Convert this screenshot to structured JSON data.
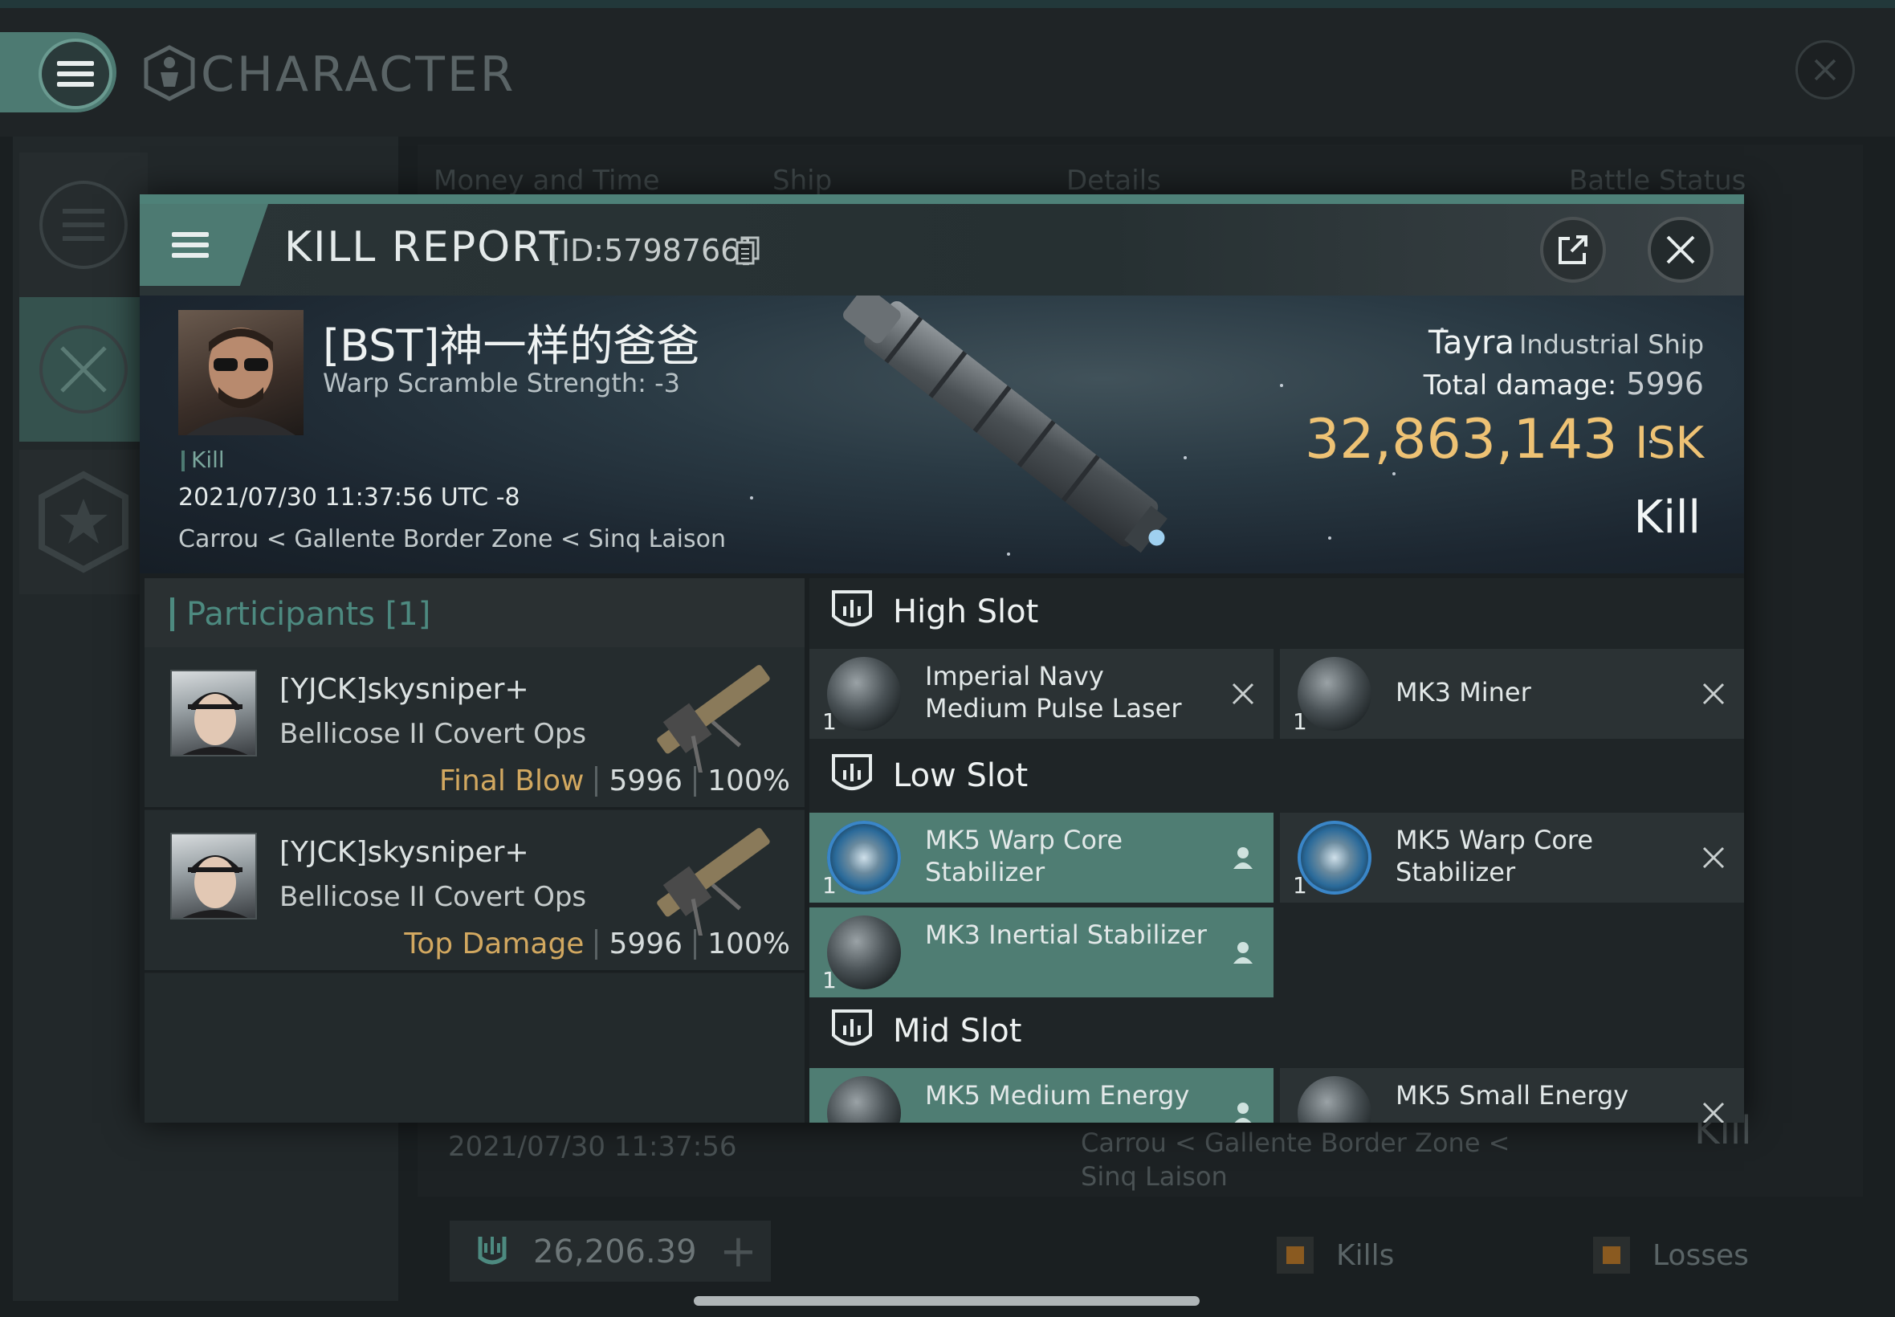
{
  "app": {
    "title": "CHARACTER",
    "columns": [
      "Money and Time",
      "Ship",
      "Details",
      "Battle Status"
    ],
    "bg_row": {
      "date": "2021/07/30  11:37:56",
      "location": "Carrou < Gallente Border Zone < Sinq Laison",
      "result": "Kill"
    },
    "wallet": {
      "value": "26,206.39",
      "add_label": "+"
    },
    "legend": {
      "kills": "Kills",
      "losses": "Losses"
    }
  },
  "report": {
    "title": "KILL REPORT",
    "id": "[ID:5798766]",
    "victim": {
      "name": "[BST]神一样的爸爸",
      "subtitle": "Warp Scramble Strength: -3",
      "tag": "Kill",
      "datetime": "2021/07/30 11:37:56 UTC -8",
      "location": "Carrou < Gallente Border Zone < Sinq Laison"
    },
    "ship": {
      "name": "Tayra",
      "class": "Industrial Ship",
      "damage_label": "Total damage:",
      "damage_value": "5996",
      "isk_value": "32,863,143",
      "isk_unit": "ISK",
      "result": "Kill"
    },
    "participants": {
      "title": "Participants [1]",
      "rows": [
        {
          "name": "[YJCK]skysniper+",
          "ship": "Bellicose II Covert Ops",
          "role": "Final Blow",
          "damage": "5996",
          "percent": "100%"
        },
        {
          "name": "[YJCK]skysniper+",
          "ship": "Bellicose II Covert Ops",
          "role": "Top Damage",
          "damage": "5996",
          "percent": "100%"
        }
      ]
    },
    "slots": {
      "high": {
        "title": "High Slot",
        "items": [
          {
            "name": "Imperial Navy Medium Pulse Laser",
            "qty": "1",
            "status": "destroyed"
          },
          {
            "name": "MK3 Miner",
            "qty": "1",
            "status": "destroyed"
          }
        ]
      },
      "low": {
        "title": "Low Slot",
        "items": [
          {
            "name": "MK5 Warp Core Stabilizer",
            "qty": "1",
            "status": "dropped"
          },
          {
            "name": "MK5 Warp Core Stabilizer",
            "qty": "1",
            "status": "destroyed"
          },
          {
            "name": "MK3 Inertial Stabilizer",
            "qty": "1",
            "status": "dropped"
          }
        ]
      },
      "mid": {
        "title": "Mid Slot",
        "items": [
          {
            "name": "MK5 Medium Energy",
            "qty": "1",
            "status": "dropped"
          },
          {
            "name": "MK5 Small Energy",
            "qty": "1",
            "status": "destroyed"
          }
        ]
      }
    }
  },
  "colors": {
    "accent": "#4d7a72",
    "isk": "#eec274",
    "role": "#d2a860",
    "fitted": "#4f7d73"
  }
}
